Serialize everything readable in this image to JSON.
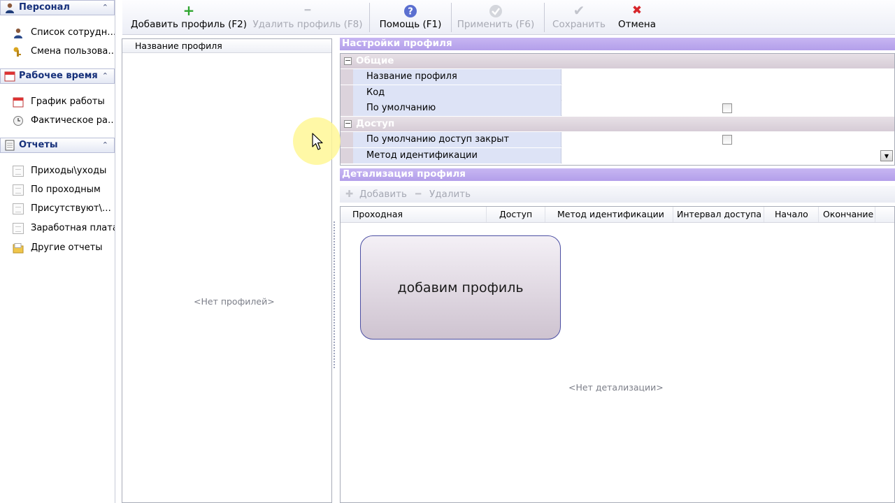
{
  "sidebar": {
    "sections": [
      {
        "title": "Персонал",
        "items": [
          {
            "label": "Список сотрудн…",
            "icon": "person-icon"
          },
          {
            "label": "Смена пользова…",
            "icon": "key-icon"
          }
        ]
      },
      {
        "title": "Рабочее время",
        "items": [
          {
            "label": "График работы",
            "icon": "calendar-icon"
          },
          {
            "label": "Фактическое ра…",
            "icon": "clock-icon"
          }
        ]
      },
      {
        "title": "Отчеты",
        "items": [
          {
            "label": "Приходы\\уходы",
            "icon": "document-icon"
          },
          {
            "label": "По проходным",
            "icon": "document-icon"
          },
          {
            "label": "Присутствуют\\…",
            "icon": "document-icon"
          },
          {
            "label": "Заработная плата",
            "icon": "document-icon"
          },
          {
            "label": "Другие отчеты",
            "icon": "folder-icon"
          }
        ]
      }
    ],
    "collapse_glyph": "⌃"
  },
  "toolbar": {
    "add": {
      "label": "Добавить профиль (F2)",
      "glyph": "+",
      "color": "#2fa52f",
      "enabled": true
    },
    "delete": {
      "label": "Удалить профиль (F8)",
      "glyph": "━",
      "color": "#c2c4cc",
      "enabled": false
    },
    "help": {
      "label": "Помощь (F1)",
      "glyph": "?",
      "color": "#5b6fd0",
      "enabled": true
    },
    "apply": {
      "label": "Применить (F6)",
      "glyph": "✔",
      "color": "#c2c4cc",
      "enabled": false
    },
    "save": {
      "label": "Сохранить",
      "glyph": "✔",
      "color": "#c2c4cc",
      "enabled": false
    },
    "cancel": {
      "label": "Отмена",
      "glyph": "✖",
      "color": "#d7262b",
      "enabled": true
    }
  },
  "profiles": {
    "column_header": "Название профиля",
    "empty_text": "<Нет профилей>"
  },
  "settings": {
    "title": "Настройки профиля",
    "groups": [
      {
        "title": "Общие",
        "rows": [
          {
            "name": "Название профиля",
            "value": ""
          },
          {
            "name": "Код",
            "value": ""
          },
          {
            "name": "По умолчанию",
            "checked": false
          }
        ]
      },
      {
        "title": "Доступ",
        "rows": [
          {
            "name": "По умолчанию доступ закрыт",
            "checked": false
          },
          {
            "name": "Метод идентификации",
            "value": ""
          }
        ]
      }
    ],
    "collapse_glyph": "−",
    "dropdown_glyph": "▼"
  },
  "detail": {
    "title": "Детализация профиля",
    "add_label": "Добавить",
    "delete_label": "Удалить",
    "columns": [
      "Проходная",
      "Доступ",
      "Метод идентификации",
      "Интервал доступа",
      "Начало",
      "Окончание"
    ],
    "empty_text": "<Нет детализации>"
  },
  "callout": {
    "text": "добавим профиль"
  },
  "colors": {
    "band": "#b8a4ec",
    "category": "#dcd3dc",
    "property_name": "#dde3f6",
    "cursor_halo": "#fff796"
  }
}
